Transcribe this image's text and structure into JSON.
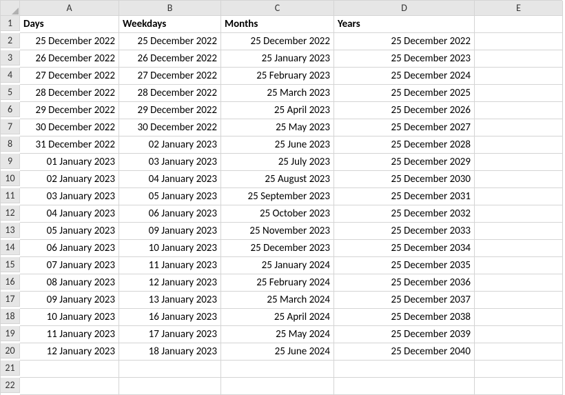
{
  "corner_icon": "select-all-triangle",
  "columns": [
    "A",
    "B",
    "C",
    "D",
    "E"
  ],
  "row_count": 22,
  "headers": {
    "A": "Days",
    "B": "Weekdays",
    "C": "Months",
    "D": "Years"
  },
  "data": {
    "A": [
      "25 December 2022",
      "26 December 2022",
      "27 December 2022",
      "28 December 2022",
      "29 December 2022",
      "30 December 2022",
      "31 December 2022",
      "01 January 2023",
      "02 January 2023",
      "03 January 2023",
      "04 January 2023",
      "05 January 2023",
      "06 January 2023",
      "07 January 2023",
      "08 January 2023",
      "09 January 2023",
      "10 January 2023",
      "11 January 2023",
      "12 January 2023"
    ],
    "B": [
      "25 December 2022",
      "26 December 2022",
      "27 December 2022",
      "28 December 2022",
      "29 December 2022",
      "30 December 2022",
      "02 January 2023",
      "03 January 2023",
      "04 January 2023",
      "05 January 2023",
      "06 January 2023",
      "09 January 2023",
      "10 January 2023",
      "11 January 2023",
      "12 January 2023",
      "13 January 2023",
      "16 January 2023",
      "17 January 2023",
      "18 January 2023"
    ],
    "C": [
      "25 December 2022",
      "25 January 2023",
      "25 February 2023",
      "25 March 2023",
      "25 April 2023",
      "25 May 2023",
      "25 June 2023",
      "25 July 2023",
      "25 August 2023",
      "25 September 2023",
      "25 October 2023",
      "25 November 2023",
      "25 December 2023",
      "25 January 2024",
      "25 February 2024",
      "25 March 2024",
      "25 April 2024",
      "25 May 2024",
      "25 June 2024"
    ],
    "D": [
      "25 December 2022",
      "25 December 2023",
      "25 December 2024",
      "25 December 2025",
      "25 December 2026",
      "25 December 2027",
      "25 December 2028",
      "25 December 2029",
      "25 December 2030",
      "25 December 2031",
      "25 December 2032",
      "25 December 2033",
      "25 December 2034",
      "25 December 2035",
      "25 December 2036",
      "25 December 2037",
      "25 December 2038",
      "25 December 2039",
      "25 December 2040"
    ]
  }
}
